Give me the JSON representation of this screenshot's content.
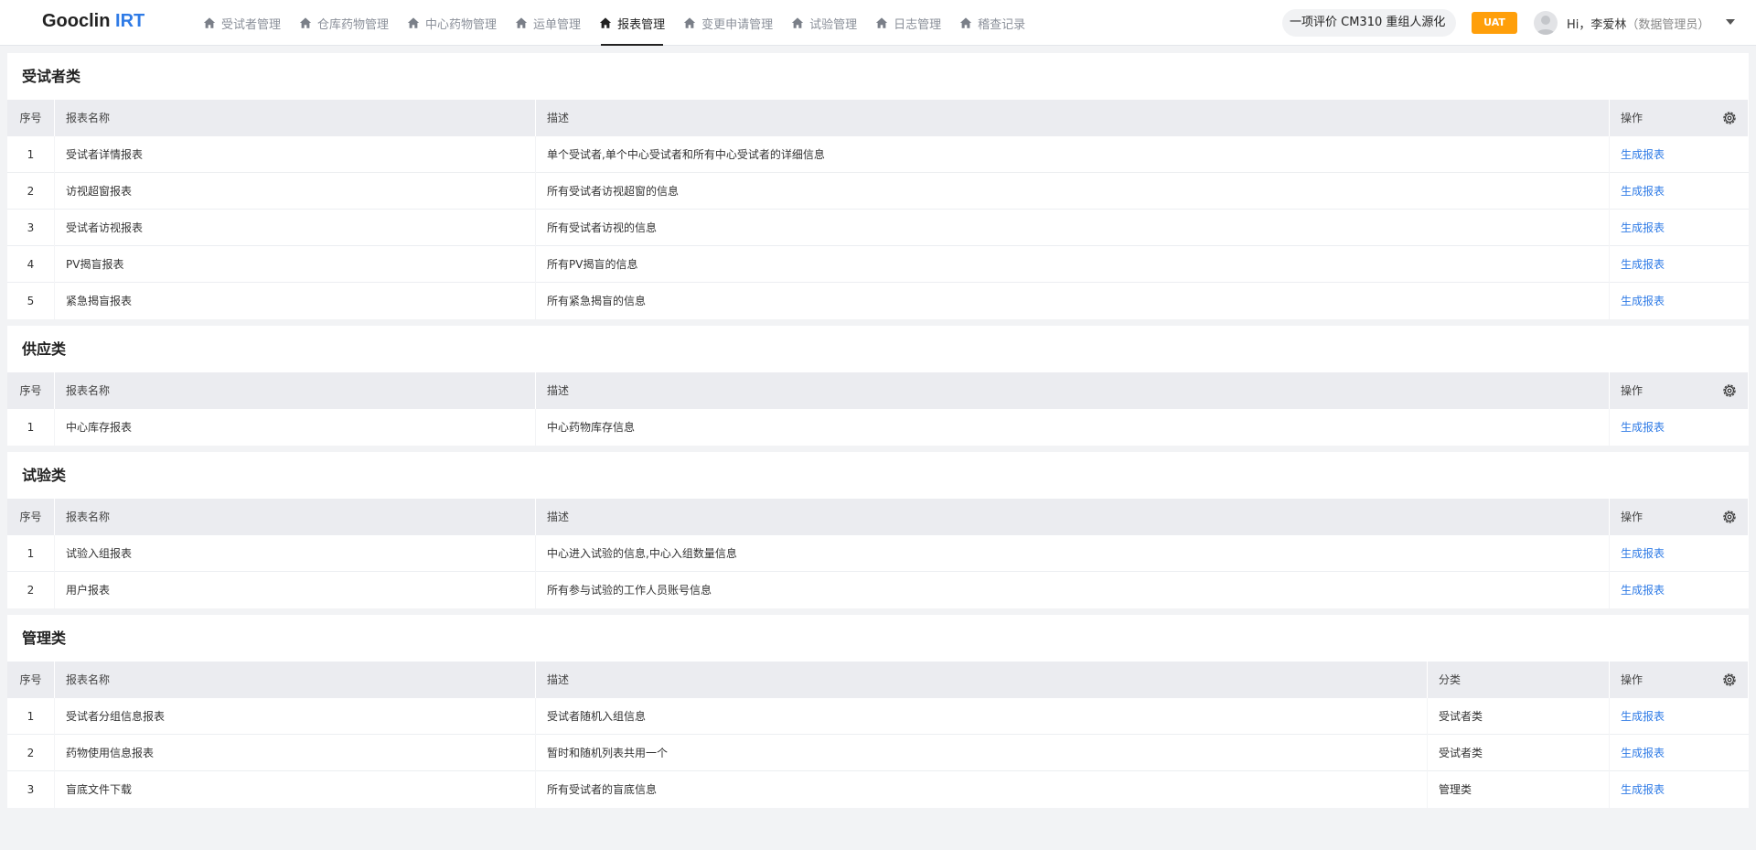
{
  "brand": {
    "name_main": "Gooclin",
    "name_accent": "IRT"
  },
  "nav": [
    {
      "label": "受试者管理",
      "icon": "home-icon",
      "active": false
    },
    {
      "label": "仓库药物管理",
      "icon": "home-icon",
      "active": false
    },
    {
      "label": "中心药物管理",
      "icon": "home-icon",
      "active": false
    },
    {
      "label": "运单管理",
      "icon": "home-icon",
      "active": false
    },
    {
      "label": "报表管理",
      "icon": "home-icon",
      "active": true
    },
    {
      "label": "变更申请管理",
      "icon": "home-icon",
      "active": false
    },
    {
      "label": "试验管理",
      "icon": "home-icon",
      "active": false
    },
    {
      "label": "日志管理",
      "icon": "home-icon",
      "active": false
    },
    {
      "label": "稽查记录",
      "icon": "home-icon",
      "active": false
    }
  ],
  "header": {
    "project": "一项评价 CM310 重组人源化",
    "env": "UAT",
    "greeting": "Hi，李爱林",
    "role": "（数据管理员）"
  },
  "columns": {
    "idx": "序号",
    "name": "报表名称",
    "desc": "描述",
    "cat": "分类",
    "op": "操作"
  },
  "action_label": "生成报表",
  "sections": [
    {
      "title": "受试者类",
      "rows": [
        {
          "idx": "1",
          "name": "受试者详情报表",
          "desc": "单个受试者,单个中心受试者和所有中心受试者的详细信息"
        },
        {
          "idx": "2",
          "name": "访视超窗报表",
          "desc": "所有受试者访视超窗的信息"
        },
        {
          "idx": "3",
          "name": "受试者访视报表",
          "desc": "所有受试者访视的信息"
        },
        {
          "idx": "4",
          "name": "PV揭盲报表",
          "desc": "所有PV揭盲的信息"
        },
        {
          "idx": "5",
          "name": "紧急揭盲报表",
          "desc": "所有紧急揭盲的信息"
        }
      ]
    },
    {
      "title": "供应类",
      "rows": [
        {
          "idx": "1",
          "name": "中心库存报表",
          "desc": "中心药物库存信息"
        }
      ]
    },
    {
      "title": "试验类",
      "rows": [
        {
          "idx": "1",
          "name": "试验入组报表",
          "desc": "中心进入试验的信息,中心入组数量信息"
        },
        {
          "idx": "2",
          "name": "用户报表",
          "desc": "所有参与试验的工作人员账号信息"
        }
      ]
    },
    {
      "title": "管理类",
      "rows": [
        {
          "idx": "1",
          "name": "受试者分组信息报表",
          "desc": "受试者随机入组信息",
          "cat": "受试者类"
        },
        {
          "idx": "2",
          "name": "药物使用信息报表",
          "desc": "暂时和随机列表共用一个",
          "cat": "受试者类"
        },
        {
          "idx": "3",
          "name": "盲底文件下载",
          "desc": "所有受试者的盲底信息",
          "cat": "管理类"
        }
      ]
    }
  ]
}
